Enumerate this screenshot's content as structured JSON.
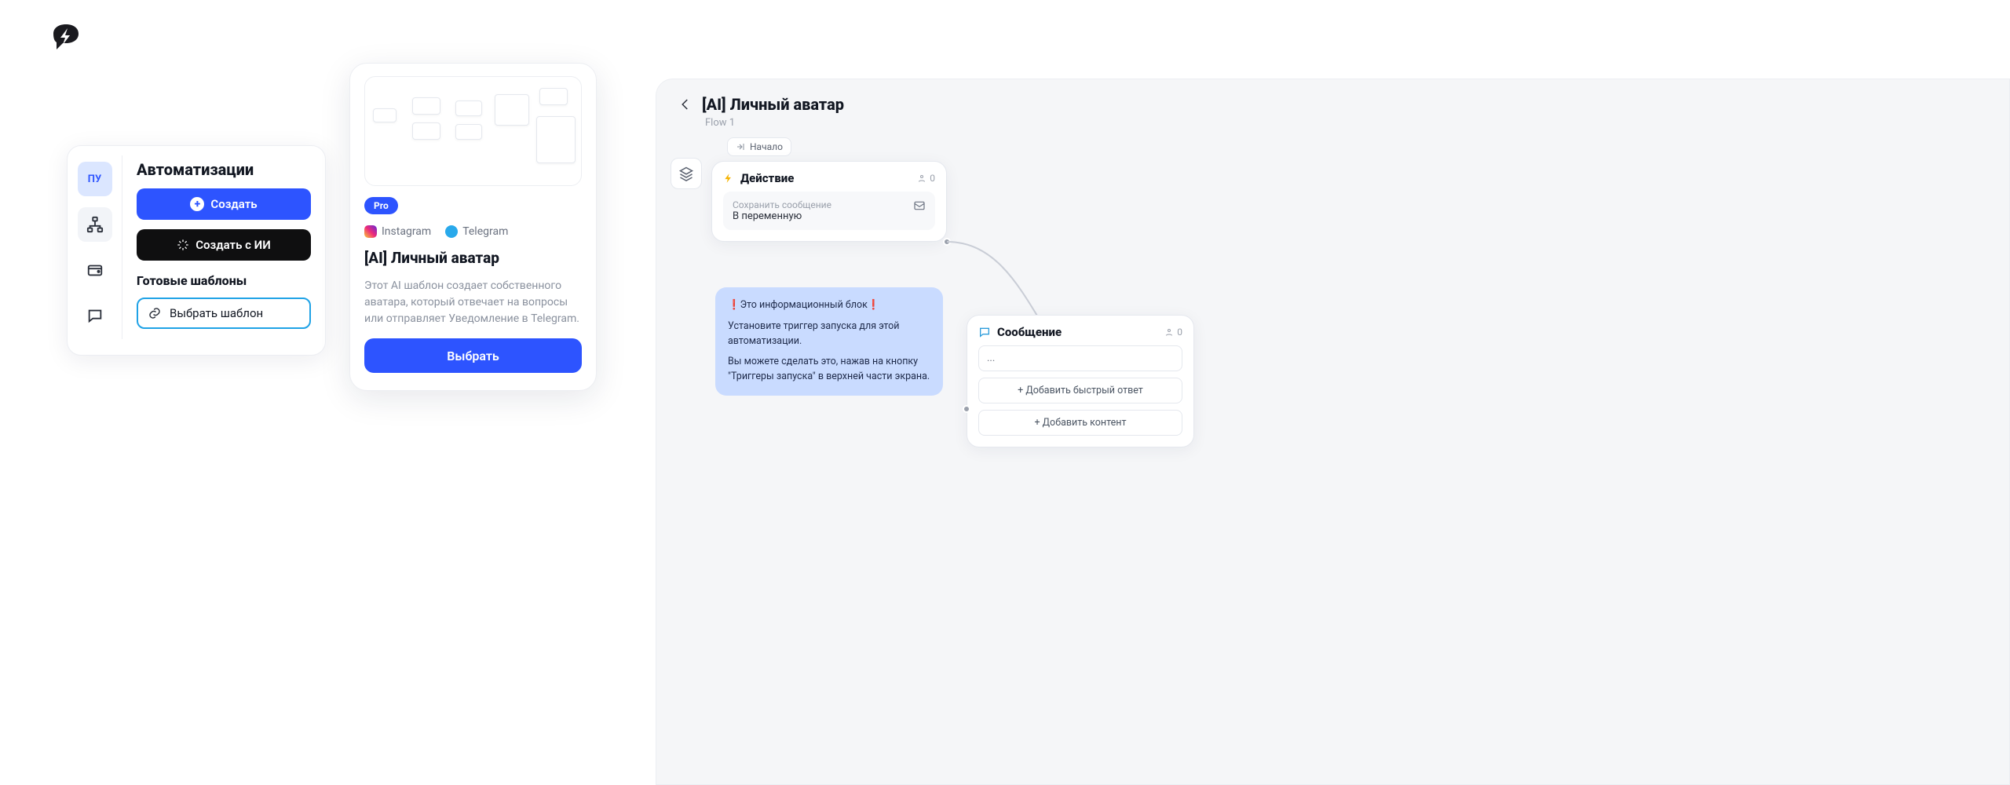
{
  "sidebar": {
    "avatar_label": "ПУ"
  },
  "left": {
    "title": "Автоматизации",
    "create": "Создать",
    "create_ai": "Создать с ИИ",
    "templates_header": "Готовые шаблоны",
    "choose_template": "Выбрать шаблон"
  },
  "card": {
    "badge": "Pro",
    "platforms": {
      "instagram": "Instagram",
      "telegram": "Telegram"
    },
    "title": "[AI] Личный аватар",
    "description": "Этот AI шаблон создает собственного аватара, который отвечает на вопросы или отправляет Уведомление в Telegram.",
    "select": "Выбрать"
  },
  "flow": {
    "title": "[AI] Личный аватар",
    "subtitle": "Flow 1",
    "start_tag": "Начало",
    "action": {
      "title": "Действие",
      "count": "0",
      "sub_label": "Сохранить сообщение",
      "sub_value": "В переменную"
    },
    "info": {
      "line1_prefix": "❗",
      "line1": "Это информационный блок",
      "line1_suffix": "❗",
      "line2": "Установите триггер запуска для этой автоматизации.",
      "line3": "Вы можете сделать это, нажав на кнопку \"Триггеры запуска\" в верхней части экрана."
    },
    "message": {
      "title": "Сообщение",
      "count": "0",
      "placeholder": "...",
      "quick_reply": "+ Добавить быстрый ответ",
      "add_content": "+ Добавить контент"
    }
  }
}
